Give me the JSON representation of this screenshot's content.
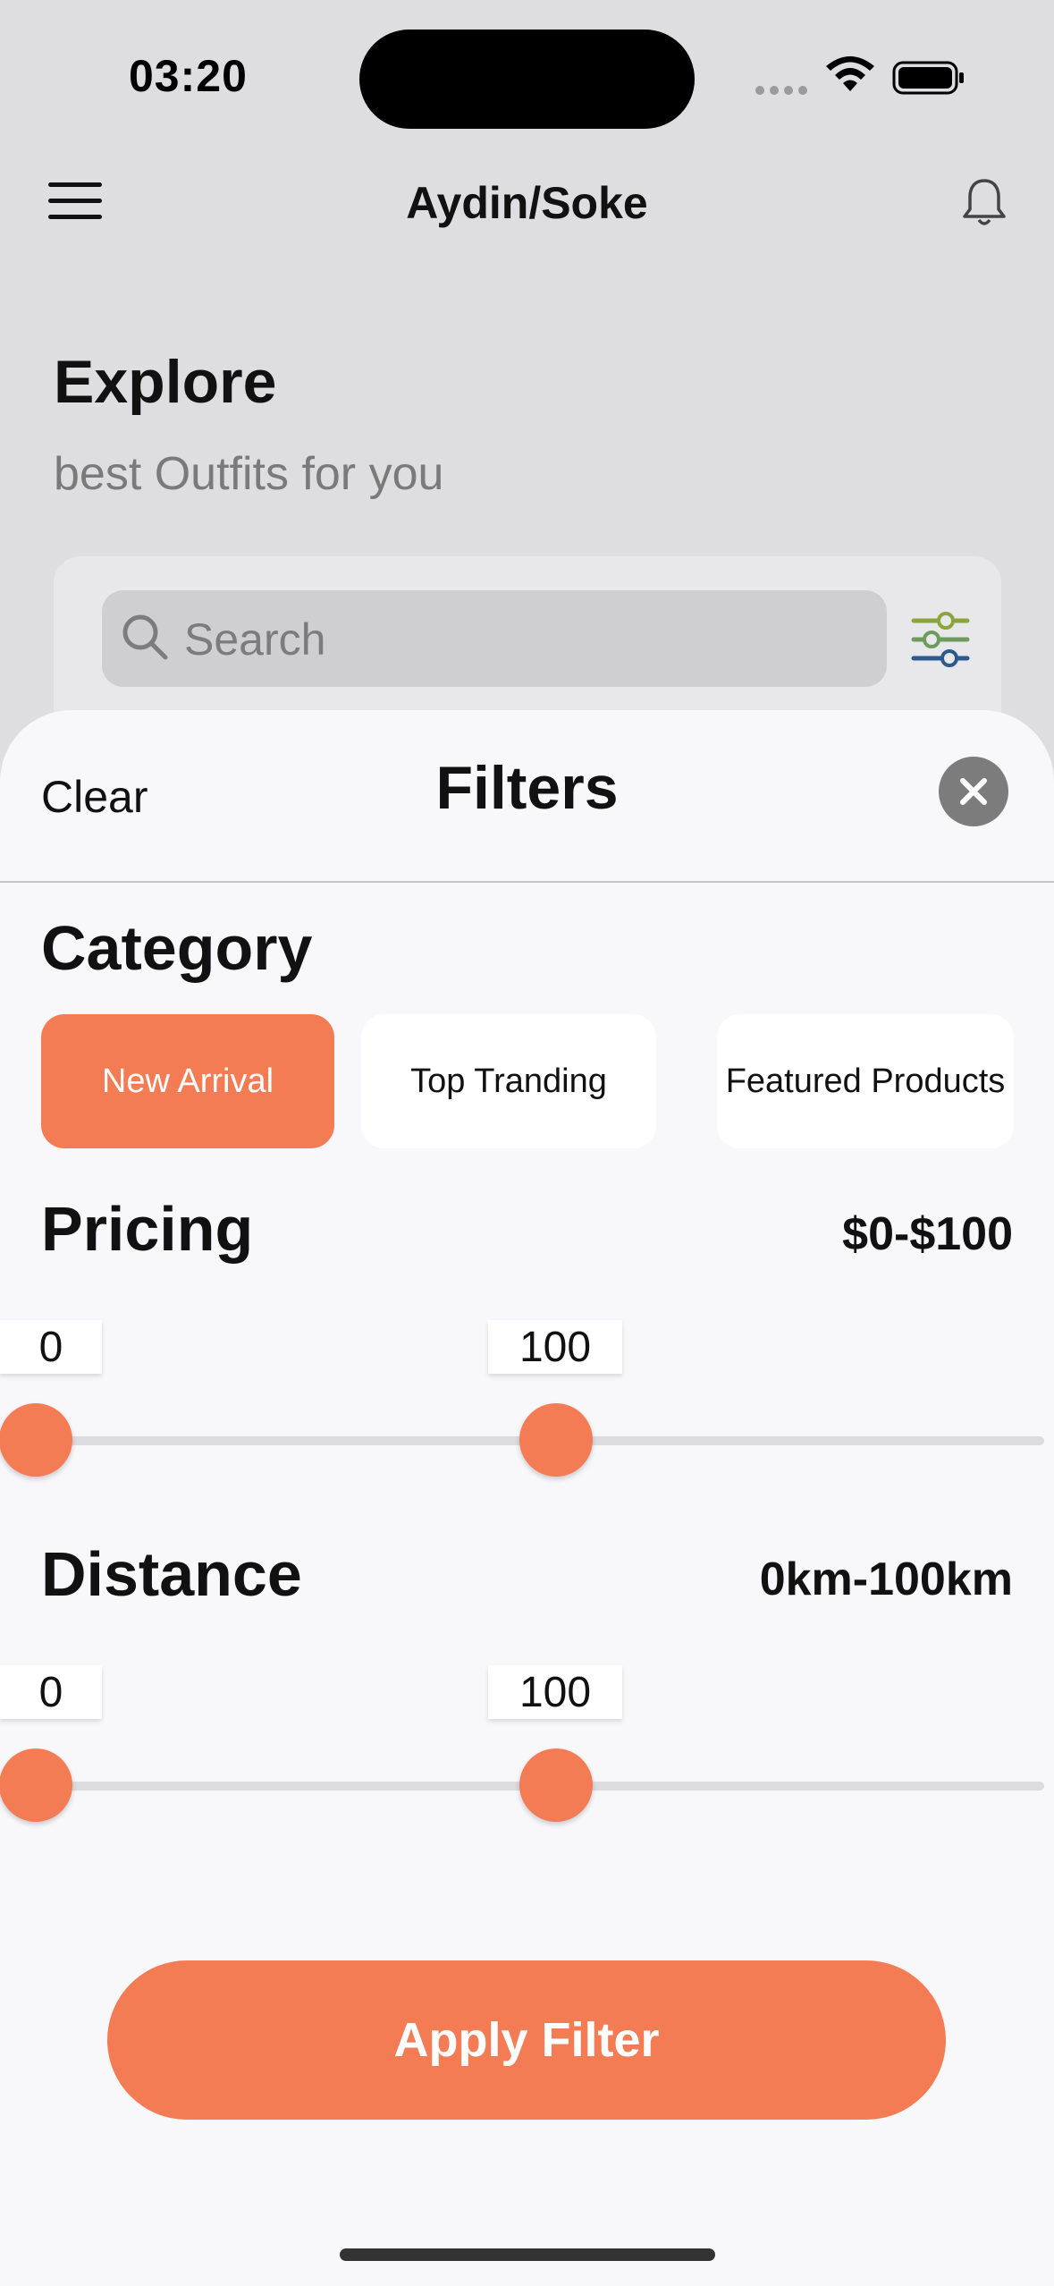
{
  "status_bar": {
    "time": "03:20"
  },
  "header": {
    "location": "Aydin/Soke"
  },
  "explore": {
    "title": "Explore",
    "subtitle": "best Outfits for you"
  },
  "search": {
    "placeholder": "Search"
  },
  "filters": {
    "clear_label": "Clear",
    "title": "Filters",
    "category": {
      "title": "Category",
      "options": [
        "New Arrival",
        "Top Tranding",
        "Featured Products"
      ],
      "selected": "New Arrival"
    },
    "pricing": {
      "title": "Pricing",
      "range_text": "$0-$100",
      "min_label": "0",
      "max_label": "100",
      "low": 0,
      "high": 100
    },
    "distance": {
      "title": "Distance",
      "range_text": "0km-100km",
      "min_label": "0",
      "max_label": "100",
      "low": 0,
      "high": 100
    },
    "apply_label": "Apply Filter"
  },
  "colors": {
    "accent": "#f47c55",
    "sheet_background": "#f8f8fb",
    "backdrop": "#dedee0"
  }
}
